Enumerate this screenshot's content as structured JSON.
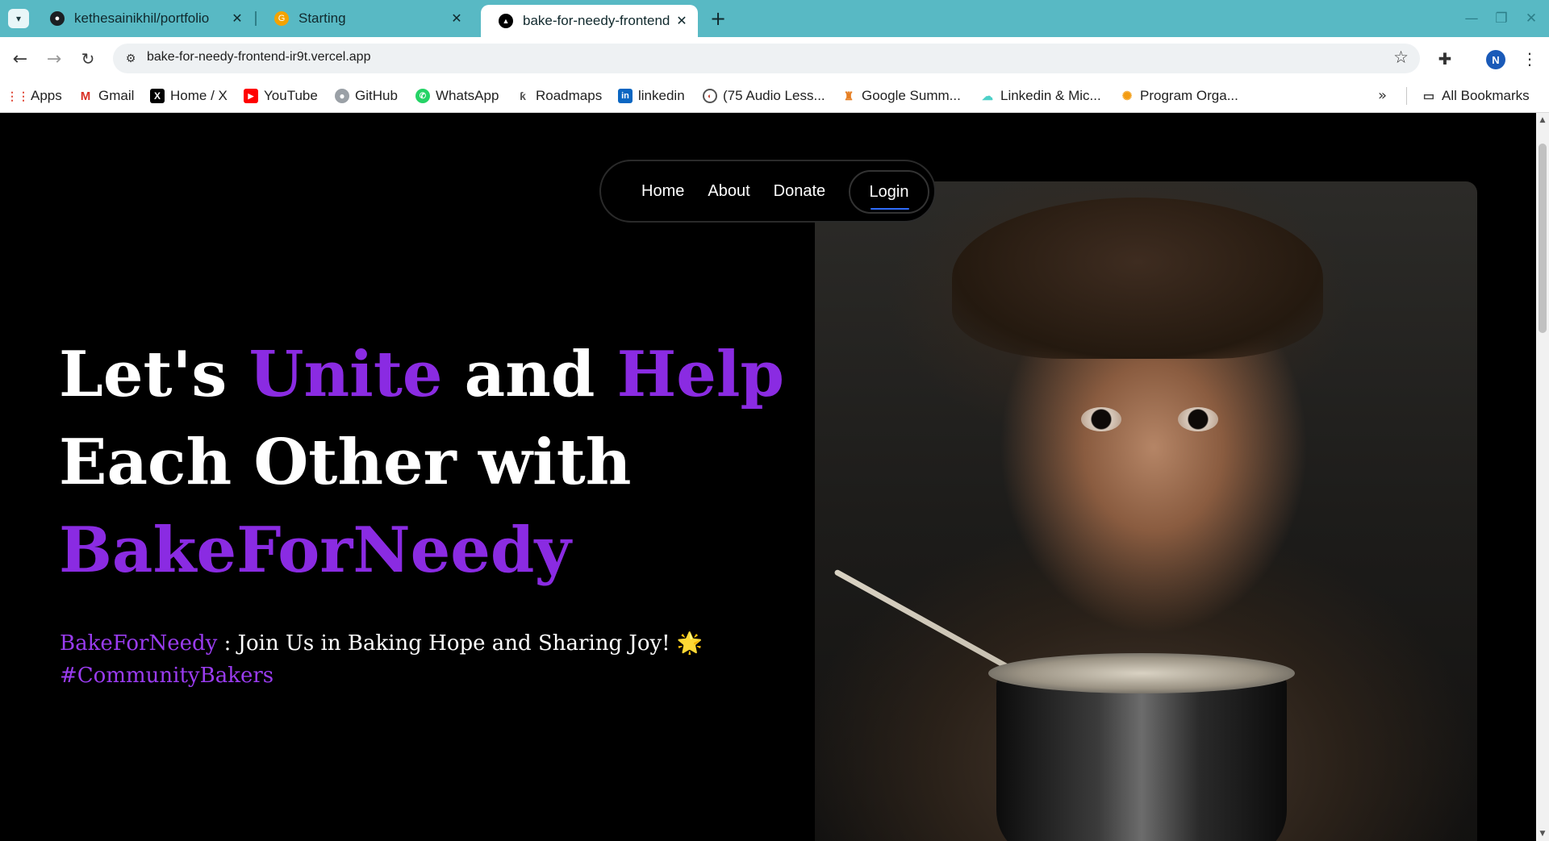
{
  "browser": {
    "tabs": [
      {
        "title": "kethesainikhil/portfolio",
        "favicon": "github-icon"
      },
      {
        "title": "Starting",
        "favicon": "google-icon"
      },
      {
        "title": "bake-for-needy-frontend",
        "favicon": "vercel-icon",
        "active": true
      }
    ],
    "url": "bake-for-needy-frontend-ir9t.vercel.app",
    "profile_initial": "N",
    "bookmarks": [
      {
        "label": "Apps",
        "icon": "apps-grid-icon"
      },
      {
        "label": "Gmail",
        "icon": "gmail-icon"
      },
      {
        "label": "Home / X",
        "icon": "x-icon"
      },
      {
        "label": "YouTube",
        "icon": "youtube-icon"
      },
      {
        "label": "GitHub",
        "icon": "github-icon"
      },
      {
        "label": "WhatsApp",
        "icon": "whatsapp-icon"
      },
      {
        "label": "Roadmaps",
        "icon": "roadmaps-icon"
      },
      {
        "label": "linkedin",
        "icon": "linkedin-icon"
      },
      {
        "label": "(75 Audio Less...",
        "icon": "audio-icon"
      },
      {
        "label": "Google Summ...",
        "icon": "google-summer-icon"
      },
      {
        "label": "Linkedin & Mic...",
        "icon": "cloud-icon"
      },
      {
        "label": "Program Orga...",
        "icon": "program-icon"
      }
    ],
    "all_bookmarks": "All Bookmarks"
  },
  "site": {
    "nav": {
      "home": "Home",
      "about": "About",
      "donate": "Donate",
      "login": "Login"
    },
    "hero": {
      "line1_a": "Let's ",
      "line1_b": "Unite",
      "line1_c": " and ",
      "line1_d": "Help",
      "line2": "Each Other with",
      "line3": "BakeForNeedy",
      "sub_brand": "BakeForNeedy",
      "sub_text": " : Join Us in Baking Hope and Sharing Joy! 🌟",
      "sub_tag": "#CommunityBakers"
    },
    "image_alt": "Child holding a pot and spoon"
  },
  "colors": {
    "accent": "#8a2be2",
    "tabbar": "#58b9c4",
    "background": "#000000"
  }
}
